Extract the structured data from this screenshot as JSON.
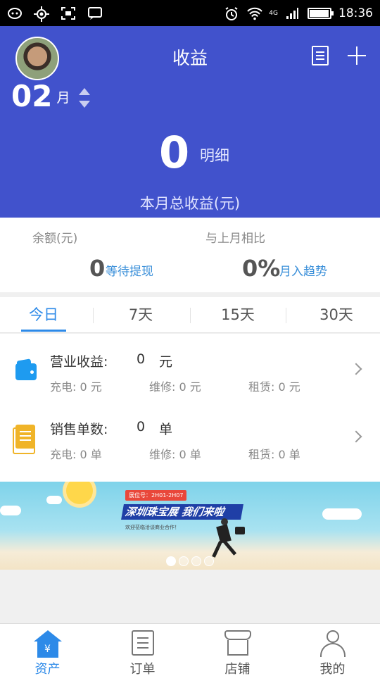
{
  "status_bar": {
    "time": "18:36",
    "network": "4G",
    "icons": [
      "wechat-icon",
      "gps-icon",
      "screenshot-icon",
      "message-icon",
      "alarm-icon",
      "wifi-icon",
      "signal-icon",
      "battery-icon"
    ]
  },
  "header": {
    "title": "收益",
    "month_value": "02",
    "month_unit": "月",
    "total_value": "0",
    "detail_label": "明细",
    "total_caption": "本月总收益(元)",
    "background_color": "#4152cc"
  },
  "balance": {
    "left_label": "余额(元)",
    "left_value": "0",
    "left_link": "等待提现",
    "right_label": "与上月相比",
    "right_value": "0%",
    "right_link": "月入趋势"
  },
  "tabs": [
    {
      "label": "今日",
      "active": true
    },
    {
      "label": "7天",
      "active": false
    },
    {
      "label": "15天",
      "active": false
    },
    {
      "label": "30天",
      "active": false
    }
  ],
  "income_rows": [
    {
      "title": "营业收益:",
      "amount": "0",
      "unit": "元",
      "sub": [
        "充电: 0 元",
        "维修: 0 元",
        "租赁: 0 元"
      ],
      "icon": "wallet-icon"
    },
    {
      "title": "销售单数:",
      "amount": "0",
      "unit": "单",
      "sub": [
        "充电: 0 单",
        "维修: 0 单",
        "租赁: 0 单"
      ],
      "icon": "document-icon"
    }
  ],
  "banner": {
    "tag": "展位号：2H01-2H07",
    "headline": "深圳珠宝展 我们来啦",
    "subline": "欢迎莅临洽谈商业合作！",
    "slide_count": 4,
    "active_slide": 1
  },
  "bottom_nav": [
    {
      "label": "资产",
      "icon": "home-yen-icon",
      "active": true
    },
    {
      "label": "订单",
      "icon": "order-list-icon",
      "active": false
    },
    {
      "label": "店铺",
      "icon": "shop-icon",
      "active": false
    },
    {
      "label": "我的",
      "icon": "person-icon",
      "active": false
    }
  ],
  "colors": {
    "accent": "#2d8ae8",
    "header_bg": "#4152cc",
    "link": "#3a8fd9",
    "wallet": "#1e9bf0",
    "document": "#f0b428"
  }
}
